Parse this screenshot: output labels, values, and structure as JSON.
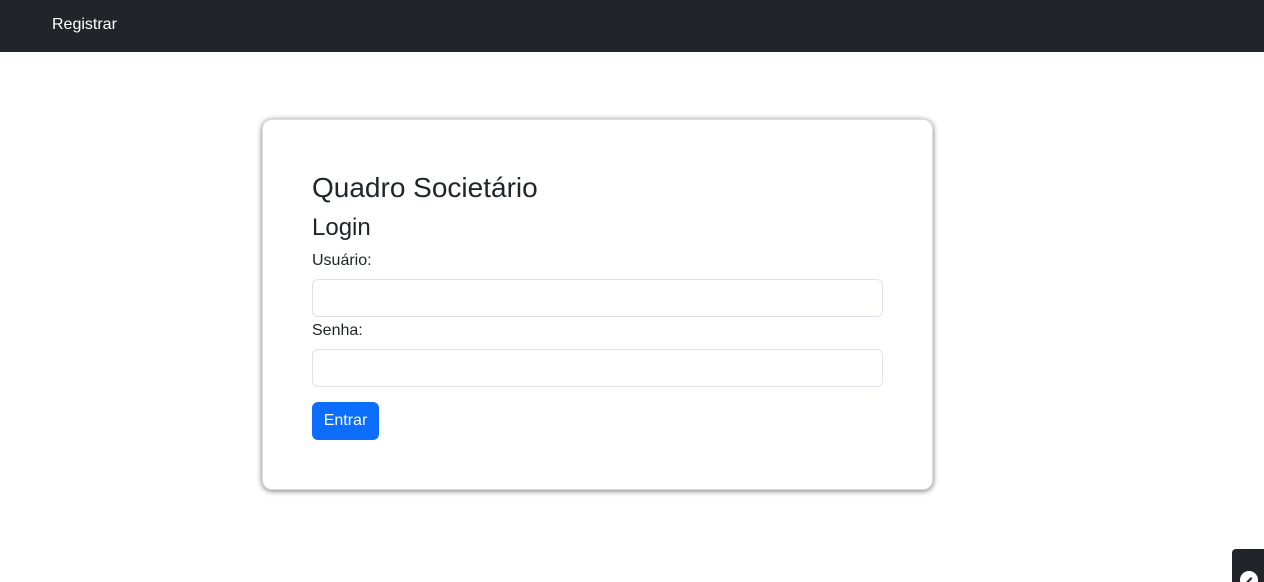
{
  "navbar": {
    "register_label": "Registrar"
  },
  "login_card": {
    "title": "Quadro Societário",
    "subtitle": "Login",
    "username_label": "Usuário:",
    "username_value": "",
    "password_label": "Senha:",
    "password_value": "",
    "submit_label": "Entrar"
  },
  "colors": {
    "navbar_bg": "#212529",
    "primary": "#0d6efd",
    "text": "#212529"
  },
  "icons": {
    "corner_widget": "edit-icon"
  }
}
